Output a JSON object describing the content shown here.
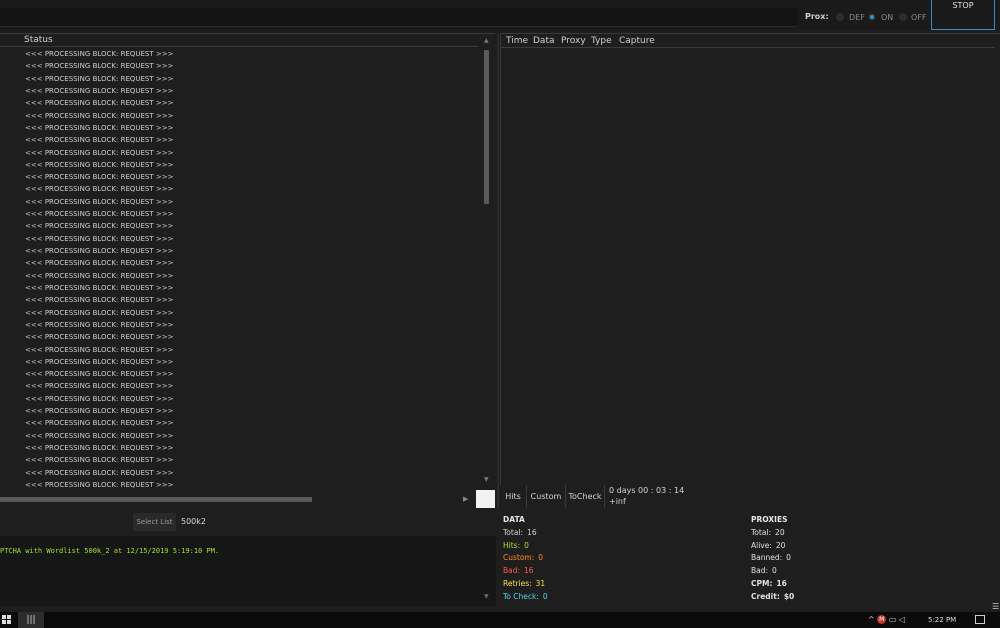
{
  "top": {
    "prox_label": "Prox:",
    "options": [
      {
        "label": "DEF",
        "selected": false
      },
      {
        "label": "ON",
        "selected": true
      },
      {
        "label": "OFF",
        "selected": false
      }
    ],
    "stop_label": "STOP"
  },
  "status_panel": {
    "header": "Status",
    "rows": [
      "<<< PROCESSING BLOCK: REQUEST >>>",
      "<<< PROCESSING BLOCK: REQUEST >>>",
      "<<< PROCESSING BLOCK: REQUEST >>>",
      "<<< PROCESSING BLOCK: REQUEST >>>",
      "<<< PROCESSING BLOCK: REQUEST >>>",
      "<<< PROCESSING BLOCK: REQUEST >>>",
      "<<< PROCESSING BLOCK: REQUEST >>>",
      "<<< PROCESSING BLOCK: REQUEST >>>",
      "<<< PROCESSING BLOCK: REQUEST >>>",
      "<<< PROCESSING BLOCK: REQUEST >>>",
      "<<< PROCESSING BLOCK: REQUEST >>>",
      "<<< PROCESSING BLOCK: REQUEST >>>",
      "<<< PROCESSING BLOCK: REQUEST >>>",
      "<<< PROCESSING BLOCK: REQUEST >>>",
      "<<< PROCESSING BLOCK: REQUEST >>>",
      "<<< PROCESSING BLOCK: REQUEST >>>",
      "<<< PROCESSING BLOCK: REQUEST >>>",
      "<<< PROCESSING BLOCK: REQUEST >>>",
      "<<< PROCESSING BLOCK: REQUEST >>>",
      "<<< PROCESSING BLOCK: REQUEST >>>",
      "<<< PROCESSING BLOCK: REQUEST >>>",
      "<<< PROCESSING BLOCK: REQUEST >>>",
      "<<< PROCESSING BLOCK: REQUEST >>>",
      "<<< PROCESSING BLOCK: REQUEST >>>",
      "<<< PROCESSING BLOCK: REQUEST >>>",
      "<<< PROCESSING BLOCK: REQUEST >>>",
      "<<< PROCESSING BLOCK: REQUEST >>>",
      "<<< PROCESSING BLOCK: REQUEST >>>",
      "<<< PROCESSING BLOCK: REQUEST >>>",
      "<<< PROCESSING BLOCK: REQUEST >>>",
      "<<< PROCESSING BLOCK: REQUEST >>>",
      "<<< PROCESSING BLOCK: REQUEST >>>",
      "<<< PROCESSING BLOCK: REQUEST >>>",
      "<<< PROCESSING BLOCK: REQUEST >>>",
      "<<< PROCESSING BLOCK: REQUEST >>>",
      "<<< PROCESSING BLOCK: REQUEST >>>"
    ]
  },
  "hits_panel": {
    "columns": [
      "Time",
      "Data",
      "Proxy",
      "Type",
      "Capture"
    ]
  },
  "tabs": [
    "Hits",
    "Custom",
    "ToCheck"
  ],
  "timer": {
    "elapsed": "0  days  00  :  03  :  14",
    "remaining": "+inf"
  },
  "wordlist": {
    "select_label": "Select List",
    "value": "500k2"
  },
  "log": {
    "line": "PTCHA  with Wordlist 500k_2 at 12/15/2019 5:19:10 PM."
  },
  "data_stats": {
    "title": "DATA",
    "rows": [
      {
        "label": "Total:",
        "value": "16",
        "color": "#d6d6d6"
      },
      {
        "label": "Hits:",
        "value": "0",
        "color": "#a6e22e"
      },
      {
        "label": "Custom:",
        "value": "0",
        "color": "#ff8c1a"
      },
      {
        "label": "Bad:",
        "value": "16",
        "color": "#ff5a4a"
      },
      {
        "label": "Retries:",
        "value": "31",
        "color": "#f0e442"
      },
      {
        "label": "To Check:",
        "value": "0",
        "color": "#4fd8e8"
      }
    ]
  },
  "proxy_stats": {
    "title": "PROXIES",
    "rows": [
      {
        "label": "Total:",
        "value": "20",
        "bold": false
      },
      {
        "label": "Alive:",
        "value": "20",
        "bold": false
      },
      {
        "label": "Banned:",
        "value": "0",
        "bold": false
      },
      {
        "label": "Bad:",
        "value": "0",
        "bold": false
      },
      {
        "label": "CPM:",
        "value": "16",
        "bold": true
      },
      {
        "label": "Credit:",
        "value": "$0",
        "bold": true
      }
    ]
  },
  "taskbar": {
    "app_glyph": "|||",
    "clock": "5:22 PM"
  }
}
